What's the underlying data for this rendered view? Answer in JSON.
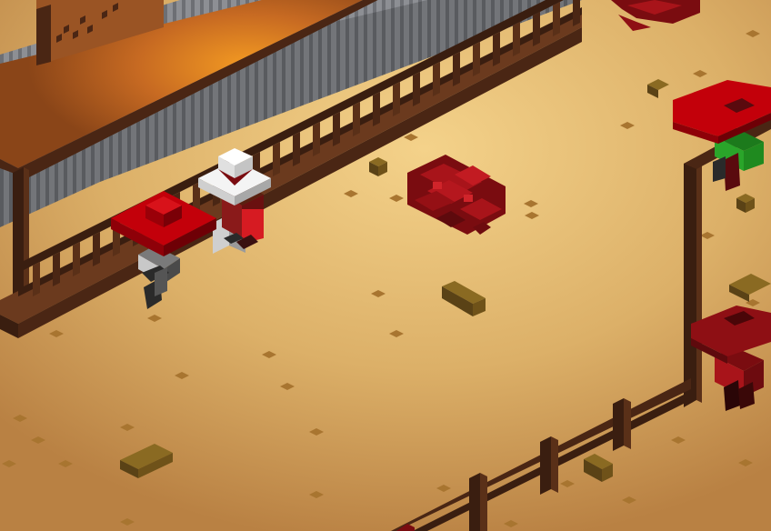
{
  "scene": {
    "kind": "isometric voxel western town street",
    "colors": {
      "ground_light": "#f2cf86",
      "ground_mid": "#deb36a",
      "ground_dark": "#c8904a",
      "building_roof": "#b8622a",
      "building_roof_glow": "#f08a1a",
      "building_wall": "#8f9196",
      "wood_dark": "#4a2614",
      "wood_mid": "#6b3a1e",
      "blood": "#8e0f14",
      "hat_red": "#c3000a",
      "hat_white": "#f4f4f4",
      "shirt_green": "#2aa52a"
    },
    "entities": [
      {
        "name": "player-cowboy-red-hat",
        "type": "character"
      },
      {
        "name": "npc-white-hat",
        "type": "character"
      },
      {
        "name": "enemy-bandit-top-right",
        "type": "character"
      },
      {
        "name": "enemy-bandit-right",
        "type": "character"
      },
      {
        "name": "blood-splatter-center",
        "type": "effect"
      },
      {
        "name": "saloon-building",
        "type": "structure"
      },
      {
        "name": "wooden-fence-bottom",
        "type": "structure"
      },
      {
        "name": "hitching-post-right",
        "type": "structure"
      }
    ]
  }
}
